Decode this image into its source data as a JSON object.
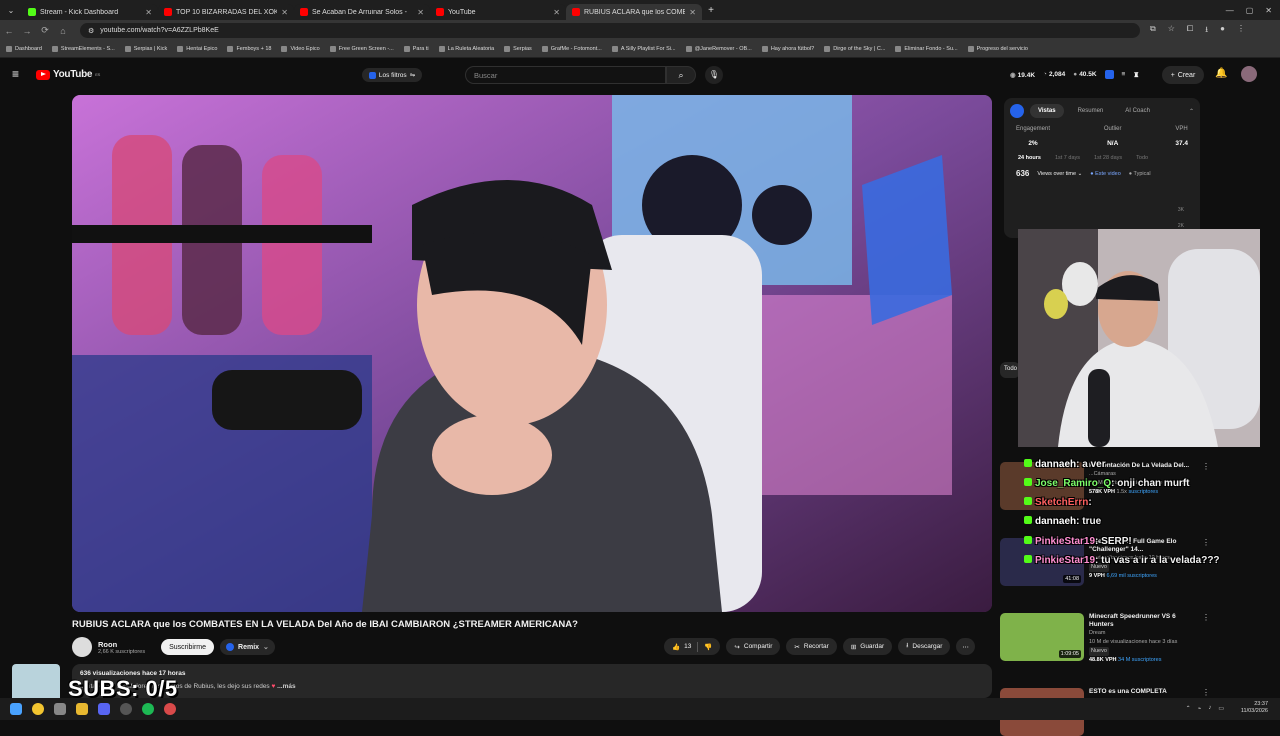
{
  "browser": {
    "tabs": [
      {
        "title": "Stream - Kick Dashboard",
        "color": "#53fc18"
      },
      {
        "title": "TOP 10 BIZARRADAS DEL XOKAS",
        "color": "#ff0000"
      },
      {
        "title": "Se Acaban De Arruinar Solos - ",
        "color": "#ff0000"
      },
      {
        "title": "YouTube",
        "color": "#ff0000"
      },
      {
        "title": "RUBIUS ACLARA que los COMB",
        "color": "#ff0000",
        "active": true
      }
    ],
    "url": "youtube.com/watch?v=A6ZZLPb8KeE",
    "bookmarks": [
      "Dashboard",
      "StreamElements - S...",
      "Serpias | Kick",
      "Hentai Epico",
      "Femboys + 18",
      "Video Epico",
      "Free Green Screen -...",
      "Para ti",
      "La Ruleta Aleatoria",
      "Serpias",
      "GrafMe - Fotomont...",
      "A Silly Playlist For Si...",
      "@JaneRemover - OB...",
      "Hay ahora fútbol?",
      "Dirge of the Sky | C...",
      "Eliminar Fondo - Su...",
      "Progreso del servicio"
    ]
  },
  "header": {
    "logo": "YouTube",
    "logo_region": "ES",
    "filters": "Los filtros",
    "search_placeholder": "Buscar",
    "stats": [
      "19.4K",
      "2,084",
      "40.5K"
    ],
    "create": "Crear"
  },
  "video": {
    "title": "RUBIUS ACLARA que los COMBATES EN LA VELADA Del Año de IBAI CAMBIARON ¿STREAMER AMERICANA?",
    "channel": "Roon",
    "subscribers": "2,66 K suscriptores",
    "subscribe": "Suscribirme",
    "remix": "Remix",
    "likes": "13",
    "share": "Compartir",
    "clip": "Recortar",
    "save": "Guardar",
    "download": "Descargar",
    "views_meta": "636 visualizaciones  hace 17 horas",
    "description": "...ditados de los Mejores momentos de Rubius, les dejo sus redes",
    "more": "...más"
  },
  "overlay": {
    "subs": "SUBS: 0/5"
  },
  "panel": {
    "tabs": [
      "Vistas",
      "Resumen",
      "AI Coach"
    ],
    "metrics": [
      {
        "label": "Engagement",
        "value": "2%"
      },
      {
        "label": "Outlier",
        "value": "N/A"
      },
      {
        "label": "VPH",
        "value": "37.4"
      }
    ],
    "ranges": [
      "24 hours",
      "1st 7 days",
      "1st 28 days",
      "Todo"
    ],
    "views_count": "636",
    "views_mode": "Views over time",
    "legend_this": "Este video",
    "legend_typical": "Typical",
    "y_ticks": [
      "3K",
      "2K"
    ]
  },
  "sidebar": {
    "chip_all": "Todo",
    "recs": [
      {
        "title": "Presentación De La Velada Del...",
        "line1": "...Cámaras",
        "line2": "1,2 M de visualizaciones  hace 23 horas",
        "vph": "578K VPH",
        "ratio": "1.5x",
        "subs": "suscriptores",
        "duration": "",
        "color": "#5a3a2a",
        "top": 462
      },
      {
        "title": "...server \"NA\" Full Game Elo \"Challenger\" 14...",
        "line1": "",
        "line2": "42 visualizaciones  hace 10 horas",
        "badge": "Nuevo",
        "vph": "9 VPH",
        "subs": "6,69 mil suscriptores",
        "duration": "41:08",
        "color": "#2a2a4a",
        "top": 538
      },
      {
        "title": "Minecraft Speedrunner VS 6 Hunters",
        "line1": "Dream",
        "line2": "10 M de visualizaciones  hace 3 días",
        "badge": "Nuevo",
        "vph": "48.8K VPH",
        "subs": "34 M suscriptores",
        "duration": "1:09:05",
        "color": "#7fb24a",
        "top": 613
      },
      {
        "title": "ESTO es una COMPLETA",
        "line1": "",
        "line2": "",
        "duration": "",
        "color": "#8a4a3a",
        "top": 688
      }
    ]
  },
  "chat": [
    {
      "user": "dannaeh",
      "text": "a ver",
      "color": "#ffffff",
      "top": 459
    },
    {
      "user": "Jose_Ramiro_Q",
      "text": "onji chan murft",
      "color": "#7dff6a",
      "top": 478
    },
    {
      "user": "SketchErrn",
      "text": "",
      "color": "#ff6060",
      "top": 497
    },
    {
      "user": "dannaeh",
      "text": "true",
      "color": "#ffffff",
      "top": 516
    },
    {
      "user": "PinkieStar19",
      "text": "SERP!",
      "color": "#ff8fd1",
      "top": 536
    },
    {
      "user": "PinkieStar19",
      "text": "tu vas a ir a la velada???",
      "color": "#ff8fd1",
      "top": 555
    }
  ],
  "system": {
    "time": "23:37",
    "date": "11/03/2026"
  }
}
